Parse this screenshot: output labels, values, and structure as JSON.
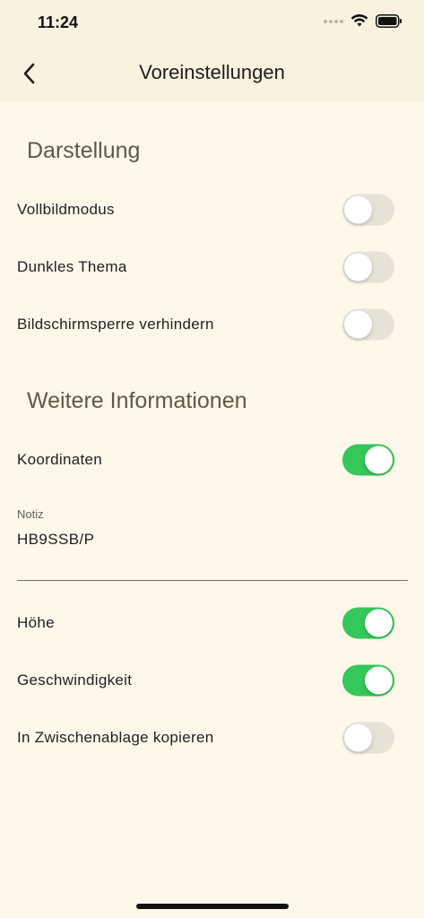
{
  "status_bar": {
    "time": "11:24"
  },
  "header": {
    "title": "Voreinstellungen"
  },
  "sections": {
    "display": {
      "title": "Darstellung",
      "items": [
        {
          "label": "Vollbildmodus",
          "on": false
        },
        {
          "label": "Dunkles Thema",
          "on": false
        },
        {
          "label": "Bildschirmsperre verhindern",
          "on": false
        }
      ]
    },
    "more_info": {
      "title": "Weitere Informationen",
      "coordinates": {
        "label": "Koordinaten",
        "on": true
      },
      "note": {
        "label": "Notiz",
        "value": "HB9SSB/P"
      },
      "items": [
        {
          "label": "Höhe",
          "on": true
        },
        {
          "label": "Geschwindigkeit",
          "on": true
        },
        {
          "label": "In Zwischenablage kopieren",
          "on": false
        }
      ]
    }
  },
  "colors": {
    "background": "#fdf8ea",
    "header_background": "#f8f2df",
    "section_title": "#5e5a43",
    "toggle_on": "#34c759",
    "toggle_off": "#e6e2d6"
  },
  "icons": {
    "back": "chevron-left-icon",
    "signal": "signal-icon",
    "wifi": "wifi-icon",
    "battery": "battery-icon"
  }
}
